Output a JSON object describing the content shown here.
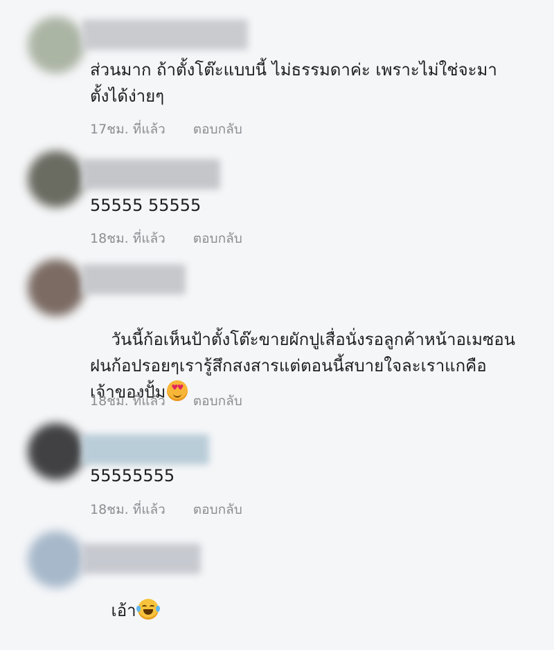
{
  "comments": [
    {
      "text": "ส่วนมาก ถ้าตั้งโต๊ะแบบนี้ ไม่ธรรมดาค่ะ เพราะไม่ใช่จะมา\nตั้งได้ง่ายๆ",
      "time": "17ชม. ที่แล้ว",
      "reply": "ตอบกลับ"
    },
    {
      "text": "55555 55555",
      "time": "18ชม. ที่แล้ว",
      "reply": "ตอบกลับ"
    },
    {
      "text": "วันนี้ก้อเห็นป้าตั้งโต๊ะขายผักปูเสื่อนั่งรอลูกค้าหน้าอเมซอน\nฝนก้อปรอยๆเรารู้สึกสงสารแต่ตอนนี้สบายใจละเราแกคือ\nเจ้าของปั้ม",
      "emoji": "smiling-face-with-hearts-emoji",
      "time": "18ชม. ที่แล้ว",
      "reply": "ตอบกลับ"
    },
    {
      "text": "55555555",
      "time": "18ชม. ที่แล้ว",
      "reply": "ตอบกลับ"
    },
    {
      "text": "เอ้า",
      "emoji": "tears-of-joy-emoji",
      "time": "",
      "reply": ""
    }
  ],
  "colors": {
    "background": "#f5f6f8",
    "text": "#1c1e21",
    "meta": "#8a8d91"
  }
}
